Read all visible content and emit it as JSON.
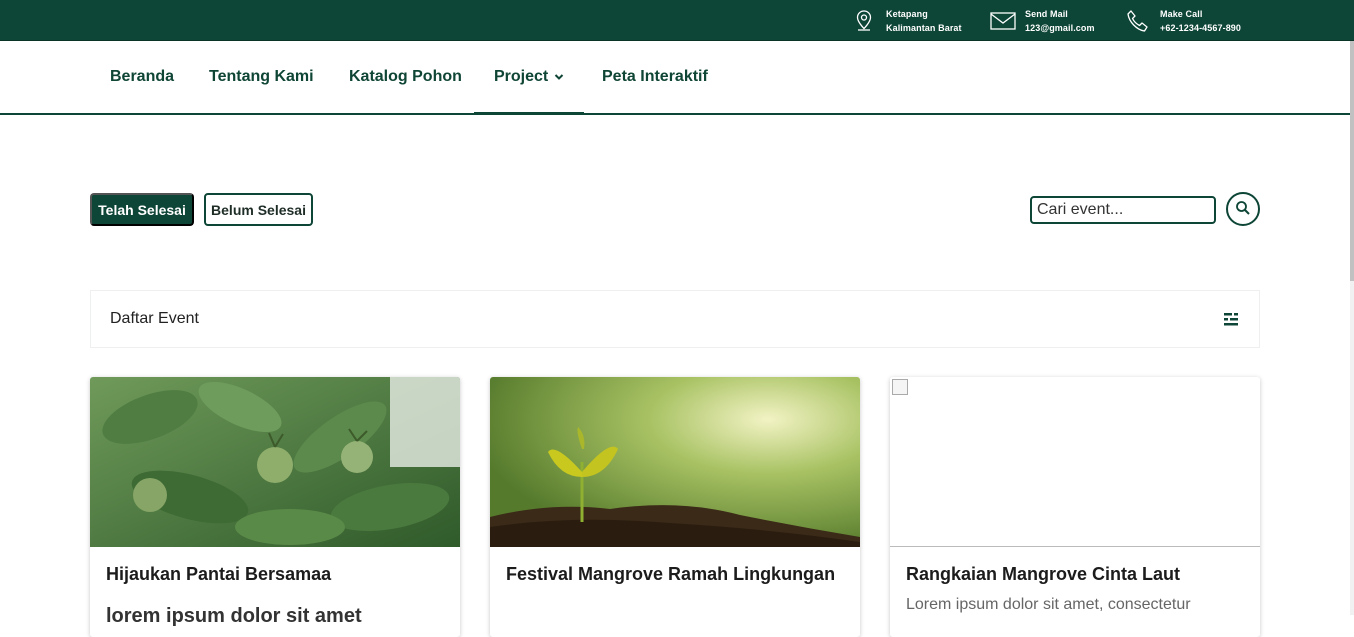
{
  "topbar": {
    "location": {
      "line1": "Ketapang",
      "line2": "Kalimantan Barat",
      "icon": "map-pin-icon"
    },
    "mail": {
      "line1": "Send Mail",
      "line2": "123@gmail.com",
      "icon": "envelope-icon"
    },
    "call": {
      "line1": "Make Call",
      "line2": "+62-1234-4567-890",
      "icon": "phone-icon"
    },
    "color": "#0d4536"
  },
  "nav": {
    "items": [
      "Beranda",
      "Tentang Kami",
      "Katalog Pohon",
      "Project",
      "Peta Interaktif"
    ],
    "active": "Project"
  },
  "filters": {
    "done_label": "Telah Selesai",
    "pending_label": "Belum Selesai"
  },
  "search": {
    "placeholder": "Cari event...",
    "icon": "search-icon"
  },
  "list": {
    "header": "Daftar Event",
    "filter_icon": "filter-sliders-icon"
  },
  "cards": [
    {
      "title": "Hijaukan Pantai Bersamaa",
      "desc": "lorem ipsum dolor sit amet"
    },
    {
      "title": "Festival Mangrove Ramah Lingkungan",
      "desc": ""
    },
    {
      "title": "Rangkaian Mangrove Cinta Laut",
      "desc": "Lorem ipsum dolor sit amet, consectetur"
    }
  ]
}
